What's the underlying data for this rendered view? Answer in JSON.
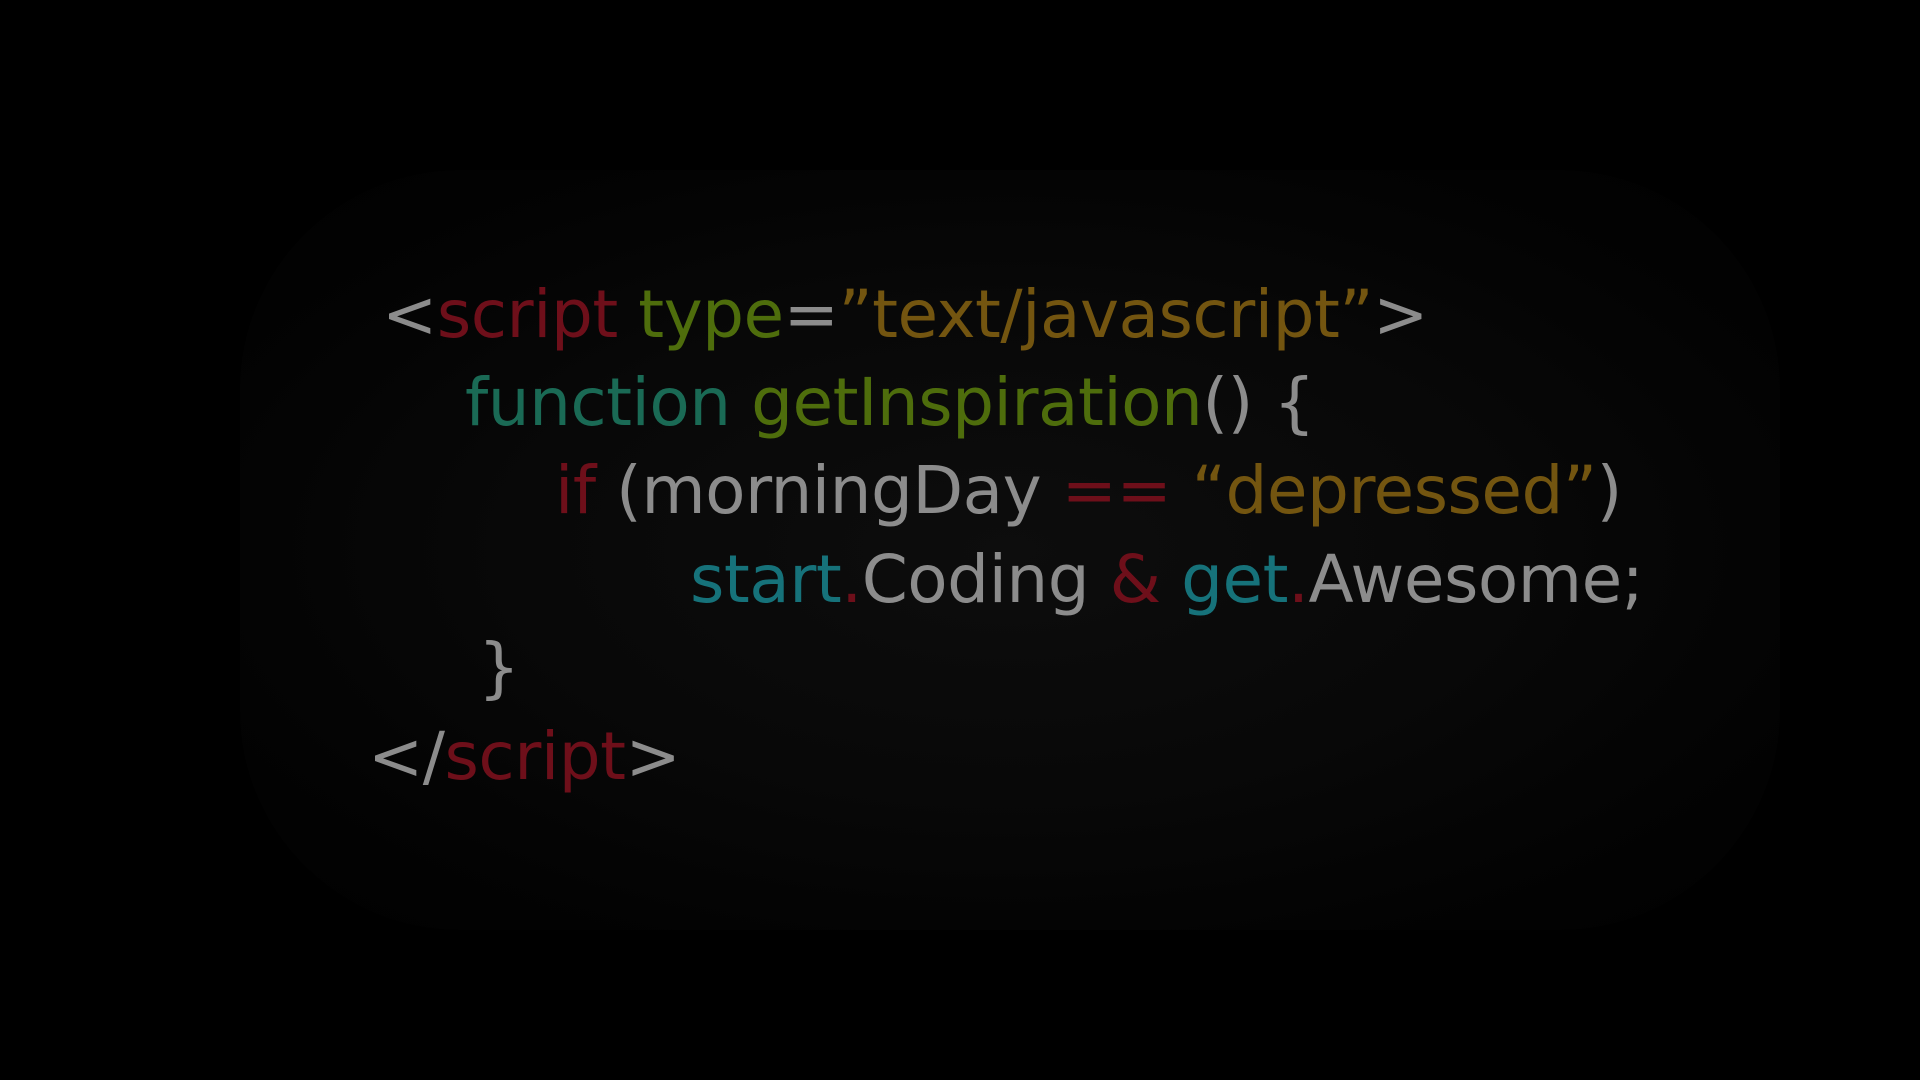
{
  "colors": {
    "background": "#000000",
    "punctuation": "#8c8c8c",
    "tag": "#6e0f1a",
    "attribute": "#4e6d0c",
    "string": "#735510",
    "keyword_function": "#1a6a55",
    "function_name": "#4e6d0c",
    "keyword_if": "#6e0f1a",
    "operator": "#6e0f1a",
    "object": "#16727a",
    "plain": "#8c8c8c"
  },
  "code": {
    "line1": {
      "lt": "<",
      "tag": "script",
      "space": " ",
      "attr": "type",
      "eq": "=",
      "value": "”text/javascript”",
      "gt": ">"
    },
    "line2": {
      "keyword": "function",
      "space": " ",
      "name": "getInspiration",
      "rest": "() {"
    },
    "line3": {
      "keyword": "if",
      "open": " (",
      "variable": "morningDay",
      "space1": " ",
      "operator": "==",
      "space2": " ",
      "value": "“depressed”",
      "close": ")"
    },
    "line4": {
      "obj1": "start",
      "dot1": ".",
      "prop1": "Coding",
      "space1": " ",
      "amp": "&",
      "space2": " ",
      "obj2": "get",
      "dot2": ".",
      "prop2": "Awesome;"
    },
    "line5": {
      "brace": "}"
    },
    "line6": {
      "open": "</",
      "tag": "script",
      "gt": ">"
    }
  }
}
